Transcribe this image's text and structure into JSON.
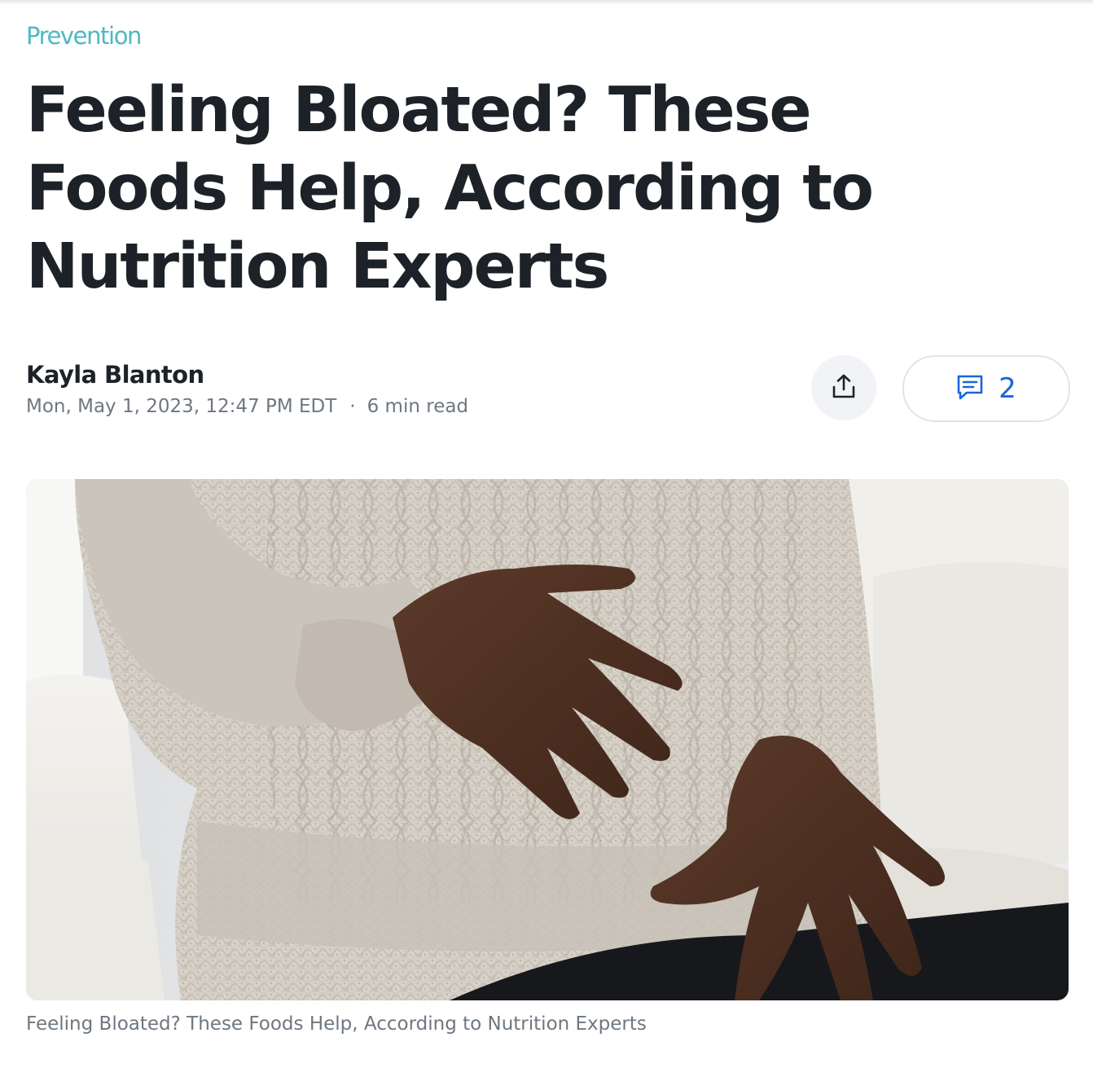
{
  "publisher": {
    "name": "Prevention"
  },
  "article": {
    "headline": "Feeling Bloated? These Foods Help, According to Nutrition Experts",
    "author": "Kayla Blanton",
    "published": "Mon, May 1, 2023, 12:47 PM EDT",
    "separator": "·",
    "read_time": "6 min read"
  },
  "actions": {
    "share_icon": "share-upload-icon",
    "comment_icon": "comment-bubble-icon",
    "comment_count": "2"
  },
  "hero_image": {
    "alt": "Feeling Bloated? These Foods Help, According to Nutrition Experts",
    "caption": "Feeling Bloated? These Foods Help, According to Nutrition Experts"
  },
  "colors": {
    "publisher_brand": "#4fb8c2",
    "headline_text": "#1d2228",
    "meta_text": "#6e7780",
    "accent_blue": "#1a64e0",
    "share_button_bg": "#f2f3f7",
    "pill_border": "#e0e4e9"
  }
}
